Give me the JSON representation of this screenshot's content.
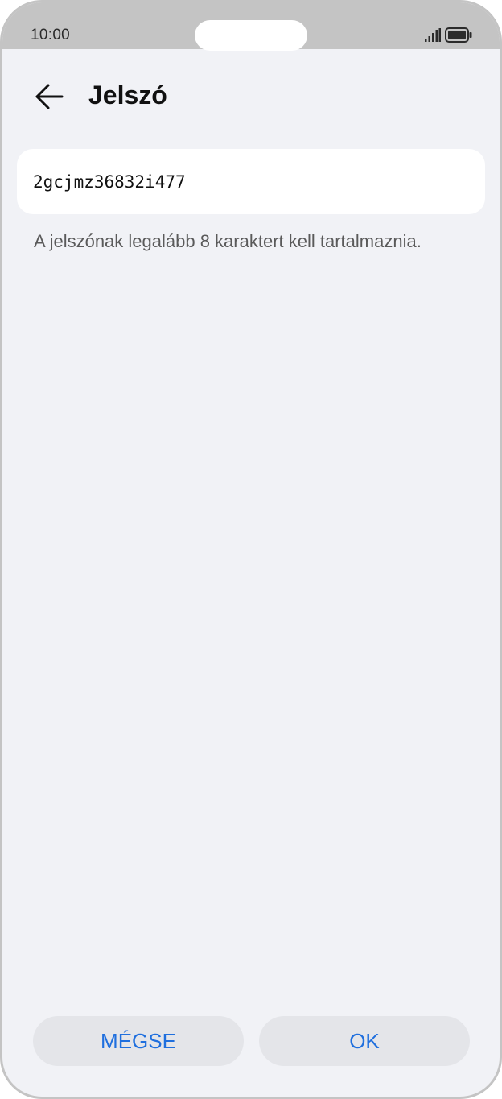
{
  "status_bar": {
    "time": "10:00",
    "signal_icon": "cellular-signal-icon",
    "battery_icon": "battery-full-icon"
  },
  "header": {
    "back_icon": "arrow-left-icon",
    "title": "Jelszó"
  },
  "password_field": {
    "value": "2gcjmz36832i477"
  },
  "hint": "A jelszónak legalább 8 karaktert kell tartalmaznia.",
  "buttons": {
    "cancel_label": "MÉGSE",
    "ok_label": "OK"
  },
  "colors": {
    "accent": "#1f6fde",
    "background": "#f1f2f6",
    "card": "#ffffff",
    "button_bg": "#e4e5e9"
  }
}
